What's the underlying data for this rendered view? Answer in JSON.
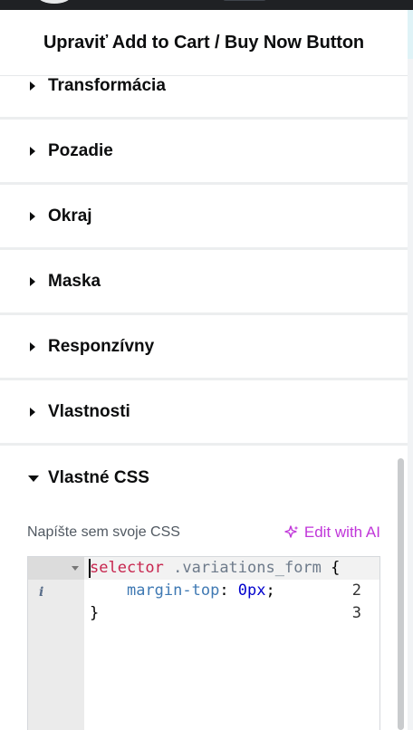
{
  "header": {
    "title": "Upraviť Add to Cart / Buy Now Button"
  },
  "sections": [
    {
      "label": "Transformácia"
    },
    {
      "label": "Pozadie"
    },
    {
      "label": "Okraj"
    },
    {
      "label": "Maska"
    },
    {
      "label": "Responzívny"
    },
    {
      "label": "Vlastnosti"
    }
  ],
  "custom_css": {
    "label": "Vlastné CSS",
    "hint": "Napíšte sem svoje CSS",
    "ai_button": "Edit with AI",
    "lines": [
      {
        "num": "1",
        "selector": "selector",
        "space": " ",
        "class": ".variations_form",
        "brace": " {"
      },
      {
        "num": "2",
        "indent": "    ",
        "prop": "margin-top",
        "colon": ": ",
        "value": "0px",
        "semi": ";"
      },
      {
        "num": "3",
        "close": "}"
      }
    ]
  },
  "colors": {
    "accent": "#c036d9",
    "selector": "#c7254e",
    "number": "#0000cd"
  }
}
